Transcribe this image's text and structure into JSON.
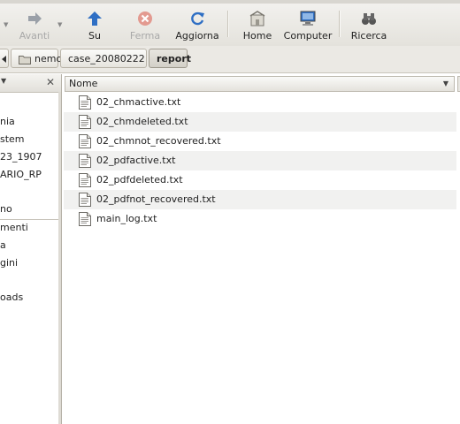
{
  "toolbar": {
    "forward_label": "Avanti",
    "stop_label": "Ferma",
    "up_label": "Su",
    "reload_label": "Aggiorna",
    "home_label": "Home",
    "computer_label": "Computer",
    "search_label": "Ricerca",
    "accent_blue": "#2f6fc4",
    "stop_red": "#d64a3a"
  },
  "pathbar": {
    "crumbs": [
      "nemo",
      "case_20080222",
      "report"
    ],
    "active_crumb": "report"
  },
  "sidebar": {
    "items": [
      "nia",
      "stem",
      "23_1907",
      "ARIO_RP",
      "no",
      "menti",
      "a",
      "gini",
      "oads"
    ]
  },
  "fileview": {
    "column_name": "Nome",
    "files": [
      "02_chmactive.txt",
      "02_chmdeleted.txt",
      "02_chmnot_recovered.txt",
      "02_pdfactive.txt",
      "02_pdfdeleted.txt",
      "02_pdfnot_recovered.txt",
      "main_log.txt"
    ]
  }
}
